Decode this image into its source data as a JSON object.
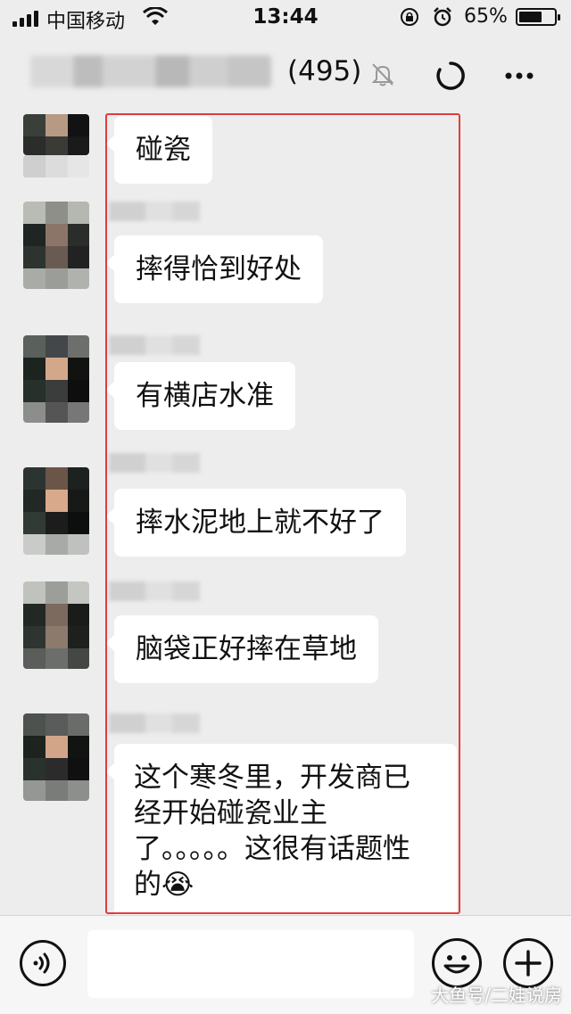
{
  "status_bar": {
    "carrier": "中国移动",
    "time": "13:44",
    "battery_percent": "65%",
    "battery_level": 0.65,
    "icons": [
      "signal-icon",
      "wifi-icon",
      "orientation-lock-icon",
      "alarm-icon",
      "battery-icon"
    ]
  },
  "nav": {
    "member_count": "(495)",
    "icons": [
      "mute-bell-icon",
      "loading-icon",
      "more-icon"
    ]
  },
  "messages": [
    {
      "text": "碰瓷"
    },
    {
      "text": "摔得恰到好处"
    },
    {
      "text": "有横店水准"
    },
    {
      "text": "摔水泥地上就不好了"
    },
    {
      "text": "脑袋正好摔在草地"
    },
    {
      "text": "这个寒冬里，开发商已经开始碰瓷业主了。。。。。这很有话题性的",
      "emoji": "😭"
    }
  ],
  "input_bar": {
    "icons": [
      "voice-icon",
      "emoji-icon",
      "plus-icon"
    ],
    "text_value": ""
  },
  "watermark": "大鱼号/二娃说房",
  "colors": {
    "background": "#ededed",
    "bubble": "#ffffff",
    "highlight_box": "#e23b3b"
  }
}
